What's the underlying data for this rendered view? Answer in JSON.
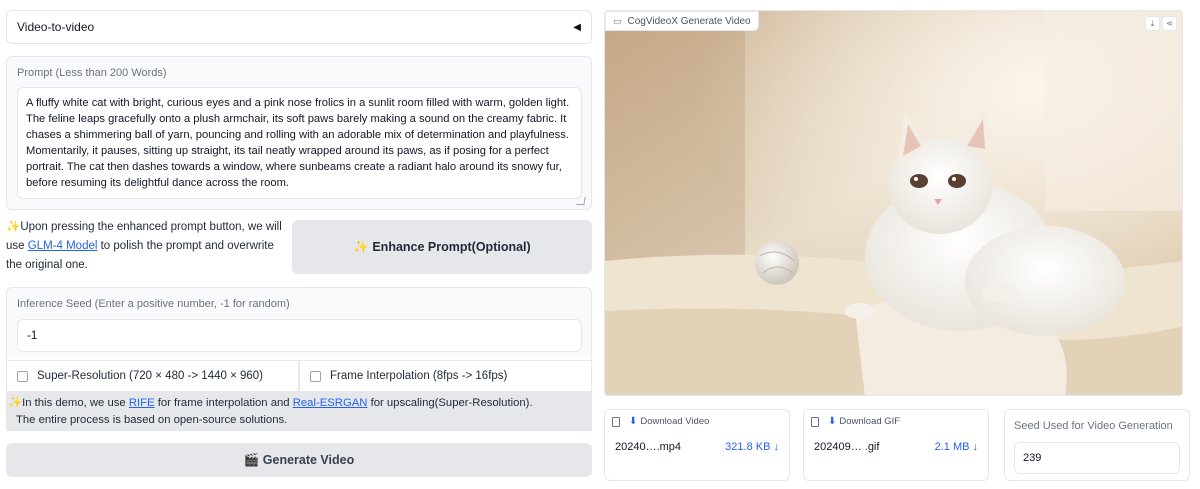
{
  "accordion": {
    "title": "Video-to-video",
    "caret": "◀"
  },
  "prompt": {
    "label": "Prompt (Less than 200 Words)",
    "value": "A fluffy white cat with bright, curious eyes and a pink nose frolics in a sunlit room filled with warm, golden light. The feline leaps gracefully onto a plush armchair, its soft paws barely making a sound on the creamy fabric. It chases a shimmering ball of yarn, pouncing and rolling with an adorable mix of determination and playfulness. Momentarily, it pauses, sitting up straight, its tail neatly wrapped around its paws, as if posing for a perfect portrait. The cat then dashes towards a window, where sunbeams create a radiant halo around its snowy fur, before resuming its delightful dance across the room."
  },
  "enhance_info": {
    "sparkle": "✨",
    "before": "Upon pressing the enhanced prompt button, we will use ",
    "link": "GLM-4 Model",
    "after": " to polish the prompt and overwrite the original one."
  },
  "enhance_button": {
    "label": "✨ Enhance Prompt(Optional)"
  },
  "seed": {
    "label": "Inference Seed (Enter a positive number, -1 for random)",
    "value": "-1"
  },
  "checkboxes": {
    "super_resolution": "Super-Resolution (720 × 480 -> 1440 × 960)",
    "frame_interpolation": "Frame Interpolation (8fps -> 16fps)"
  },
  "notice": {
    "sparkle": "✨",
    "part1": "In this demo, we use ",
    "rife": "RIFE",
    "part2": " for frame interpolation and ",
    "esrgan": "Real-ESRGAN",
    "part3": " for upscaling(Super-Resolution).",
    "line2": "The entire process is based on open-source solutions."
  },
  "generate_button": {
    "label": "🎬 Generate Video"
  },
  "video": {
    "tag": "CogVideoX Generate Video",
    "download_icon": "download-icon",
    "share_icon": "share-icon"
  },
  "video_file": {
    "label": "Download Video",
    "name": "20240….mp4",
    "size": "321.8 KB ↓"
  },
  "gif_file": {
    "label": "Download GIF",
    "name": "202409… .gif",
    "size": "2.1 MB ↓"
  },
  "seed_used": {
    "label": "Seed Used for Video Generation",
    "value": "239"
  },
  "colors": {
    "link": "#2563eb",
    "button_bg": "#e5e7eb",
    "panel_bg": "#f9fafb"
  }
}
